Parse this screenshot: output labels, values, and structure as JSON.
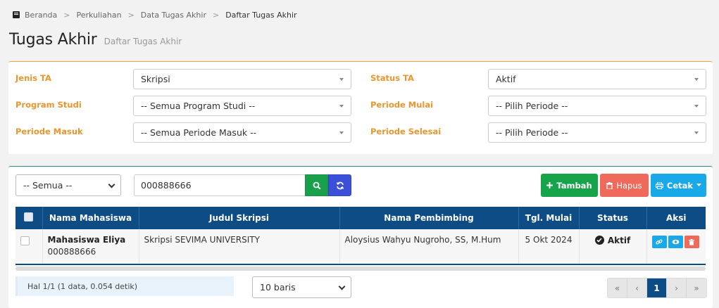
{
  "breadcrumb": {
    "items": [
      "Beranda",
      "Perkuliahan",
      "Data Tugas Akhir",
      "Daftar Tugas Akhir"
    ],
    "separator": ">"
  },
  "page": {
    "title": "Tugas Akhir",
    "subtitle": "Daftar Tugas Akhir"
  },
  "filters": {
    "jenis_ta": {
      "label": "Jenis TA",
      "value": "Skripsi"
    },
    "program_studi": {
      "label": "Program Studi",
      "value": "-- Semua Program Studi --"
    },
    "periode_masuk": {
      "label": "Periode Masuk",
      "value": "-- Semua Periode Masuk --"
    },
    "status_ta": {
      "label": "Status TA",
      "value": "Aktif"
    },
    "periode_mulai": {
      "label": "Periode Mulai",
      "value": "-- Pilih Periode --"
    },
    "periode_selesai": {
      "label": "Periode Selesai",
      "value": "-- Pilih Periode --"
    }
  },
  "toolbar": {
    "scope_select": "-- Semua --",
    "search_value": "000888666",
    "add_label": "Tambah",
    "delete_label": "Hapus",
    "print_label": "Cetak"
  },
  "table": {
    "headers": [
      "Nama Mahasiswa",
      "Judul Skripsi",
      "Nama Pembimbing",
      "Tgl. Mulai",
      "Status",
      "Aksi"
    ],
    "rows": [
      {
        "name": "Mahasiswa Eliya",
        "nim": "000888666",
        "judul": "Skripsi SEVIMA UNIVERSITY",
        "pembimbing": "Aloysius Wahyu Nugroho, SS, M.Hum",
        "tgl_mulai": "5 Okt 2024",
        "status": "Aktif"
      }
    ]
  },
  "footer": {
    "info": "Hal 1/1 (1 data, 0.054 detik)",
    "rows_per_page": "10 baris",
    "pager": [
      "«",
      "‹",
      "1",
      "›",
      "»"
    ],
    "current_page": "1"
  },
  "colors": {
    "accent_orange": "#e8962e",
    "table_header": "#0e4c86",
    "green": "#16a34a",
    "red": "#ef6a5a",
    "blue": "#19a8e8"
  }
}
